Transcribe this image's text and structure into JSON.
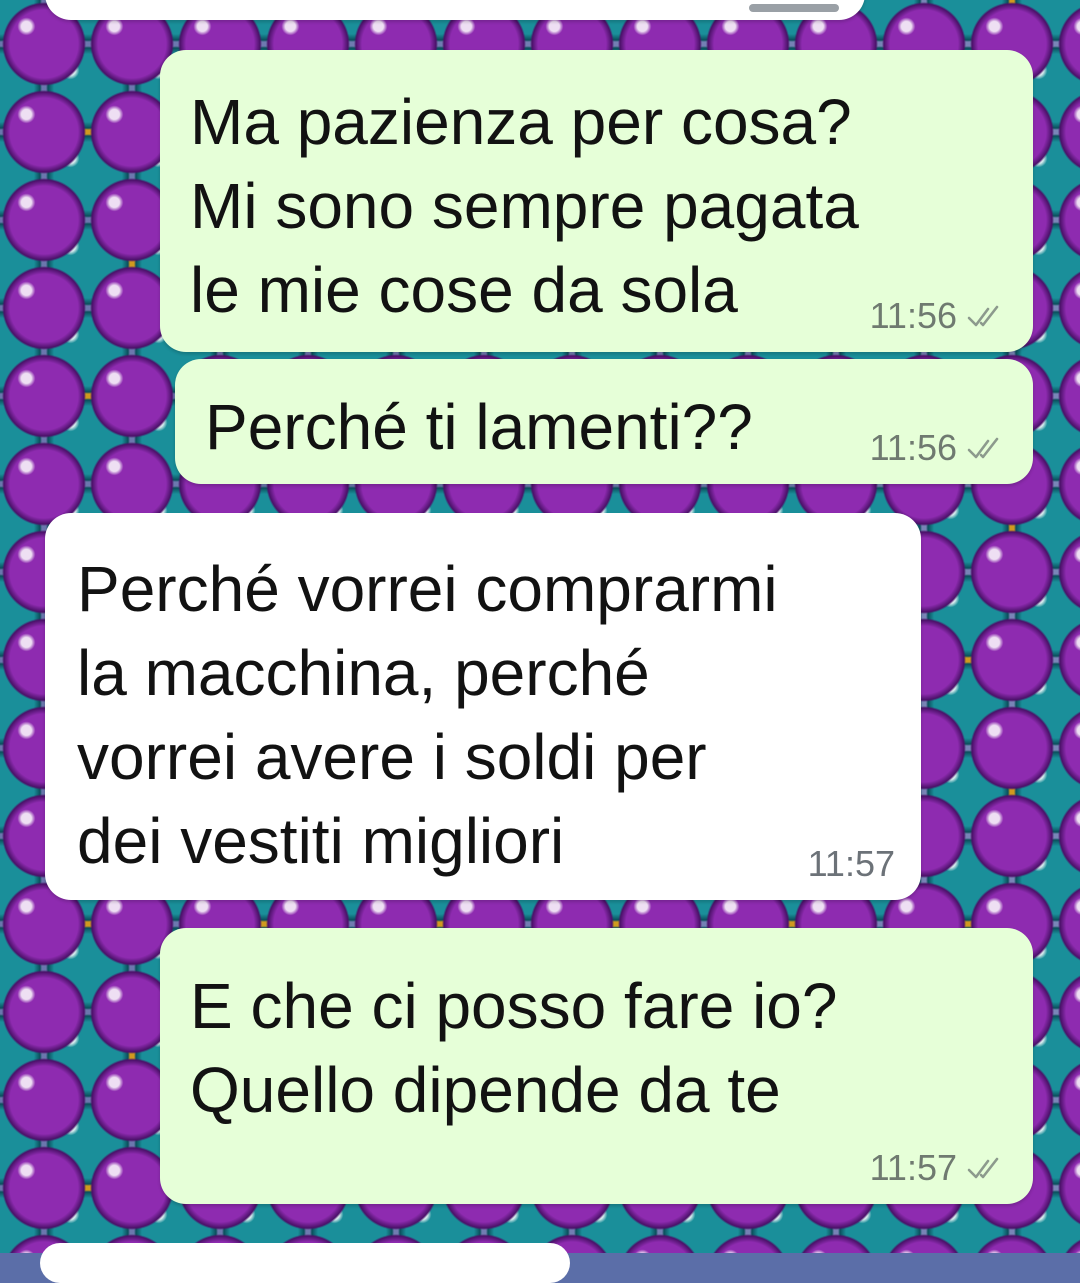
{
  "conversation": {
    "messages": [
      {
        "direction": "out",
        "text": "Ma pazienza per cosa?\nMi sono sempre pagata\nle mie cose da sola",
        "time": "11:56",
        "status_icon": "double-check-icon"
      },
      {
        "direction": "out",
        "text": "Perché ti lamenti??",
        "time": "11:56",
        "status_icon": "double-check-icon"
      },
      {
        "direction": "in",
        "text": "Perché vorrei comprarmi\nla macchina, perché\nvorrei avere i soldi per\ndei vestiti migliori",
        "time": "11:57"
      },
      {
        "direction": "out",
        "text": "E che ci posso fare io?\nQuello dipende da te",
        "time": "11:57",
        "status_icon": "double-check-icon"
      }
    ]
  },
  "colors": {
    "outgoing_bubble": "#e6ffd8",
    "incoming_bubble": "#ffffff",
    "timestamp": "#6f7a70",
    "text": "#121212"
  }
}
